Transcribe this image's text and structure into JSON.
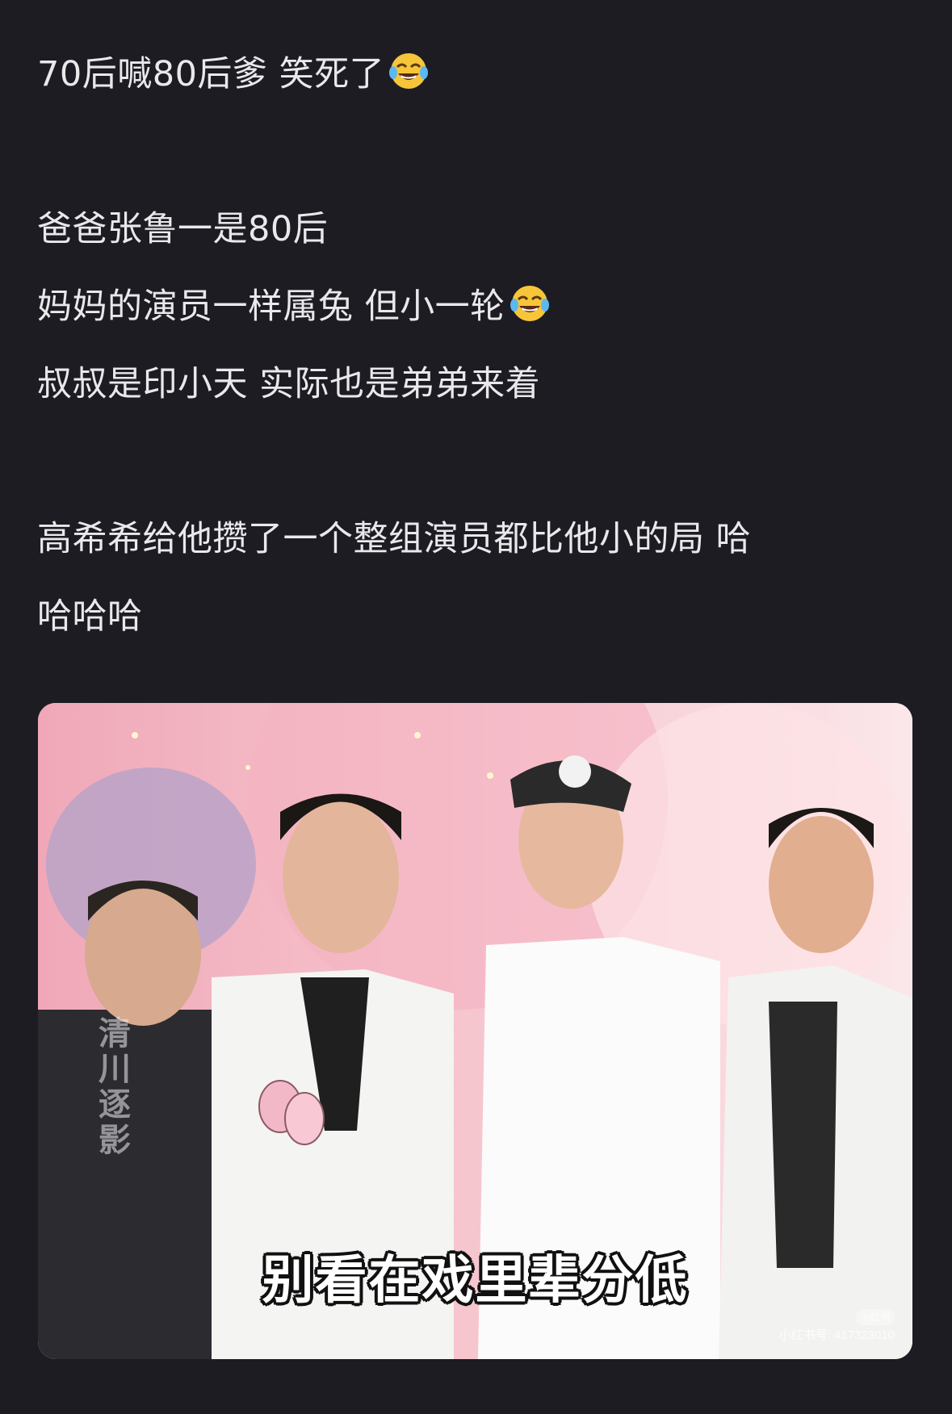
{
  "post": {
    "lines": [
      "70后喊80后爹 笑死了",
      "",
      "爸爸张鲁一是80后",
      "妈妈的演员一样属兔 但小一轮",
      "叔叔是印小天 实际也是弟弟来着",
      "",
      "高希希给他攒了一个整组演员都比他小的局 哈",
      "哈哈哈"
    ],
    "emoji": "tears-of-joy-emoji"
  },
  "image": {
    "caption": "别看在戏里辈分低",
    "watermark_vertical": "清川逐影",
    "corner_logo": "小红书",
    "corner_watermark": "小红书号: 417323010"
  },
  "colors": {
    "background": "#1c1c22",
    "text": "#e9e9ec"
  }
}
